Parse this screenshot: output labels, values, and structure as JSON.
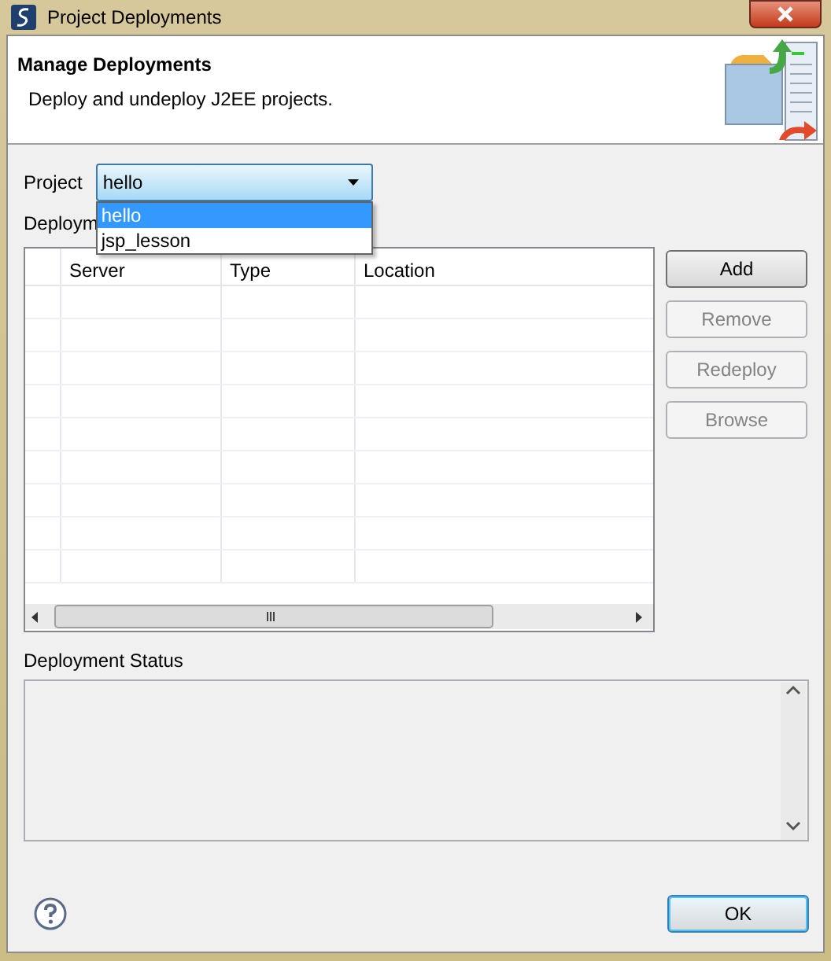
{
  "window": {
    "title": "Project Deployments"
  },
  "header": {
    "title": "Manage Deployments",
    "description": "Deploy and undeploy J2EE projects."
  },
  "project": {
    "label": "Project",
    "value": "hello",
    "expanded": true,
    "options": [
      {
        "label": "hello",
        "selected": true
      },
      {
        "label": "jsp_lesson",
        "selected": false
      }
    ]
  },
  "deployments": {
    "label": "Deploym",
    "columns": [
      "Server",
      "Type",
      "Location"
    ]
  },
  "side_buttons": [
    {
      "label": "Add",
      "disabled": false
    },
    {
      "label": "Remove",
      "disabled": true
    },
    {
      "label": "Redeploy",
      "disabled": true
    },
    {
      "label": "Browse",
      "disabled": true
    }
  ],
  "status": {
    "label": "Deployment Status"
  },
  "ok_button": {
    "label": "OK"
  }
}
